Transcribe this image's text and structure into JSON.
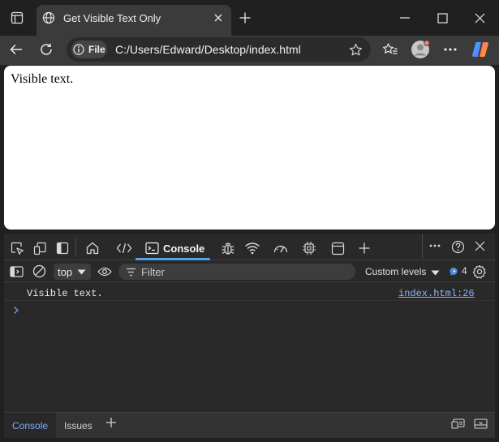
{
  "browser": {
    "tab_title": "Get Visible Text Only",
    "address": {
      "scheme_label": "File",
      "url": "C:/Users/Edward/Desktop/index.html"
    }
  },
  "page": {
    "body_text": "Visible text."
  },
  "devtools": {
    "tabs": [
      {
        "name": "welcome",
        "icon": "home-icon"
      },
      {
        "name": "elements",
        "icon": "code-icon"
      },
      {
        "name": "console",
        "label": "Console",
        "icon": "console-icon",
        "active": true
      },
      {
        "name": "sources",
        "icon": "bug-icon"
      },
      {
        "name": "network",
        "icon": "wifi-icon"
      },
      {
        "name": "performance",
        "icon": "gauge-icon"
      },
      {
        "name": "memory",
        "icon": "chip-icon"
      },
      {
        "name": "application",
        "icon": "window-icon"
      }
    ],
    "console_toolbar": {
      "context": "top",
      "filter_placeholder": "Filter",
      "levels_label": "Custom levels",
      "issues_count": "4"
    },
    "messages": [
      {
        "text": "Visible text.",
        "source": "index.html:26"
      }
    ],
    "drawer": {
      "tabs": [
        "Console",
        "Issues"
      ],
      "active": "Console"
    }
  },
  "colors": {
    "accent": "#5aa0e6",
    "link": "#8ab4f8",
    "copilot": [
      "#1ec8ff",
      "#7b5cff",
      "#ff5c8a",
      "#ffb000"
    ]
  }
}
